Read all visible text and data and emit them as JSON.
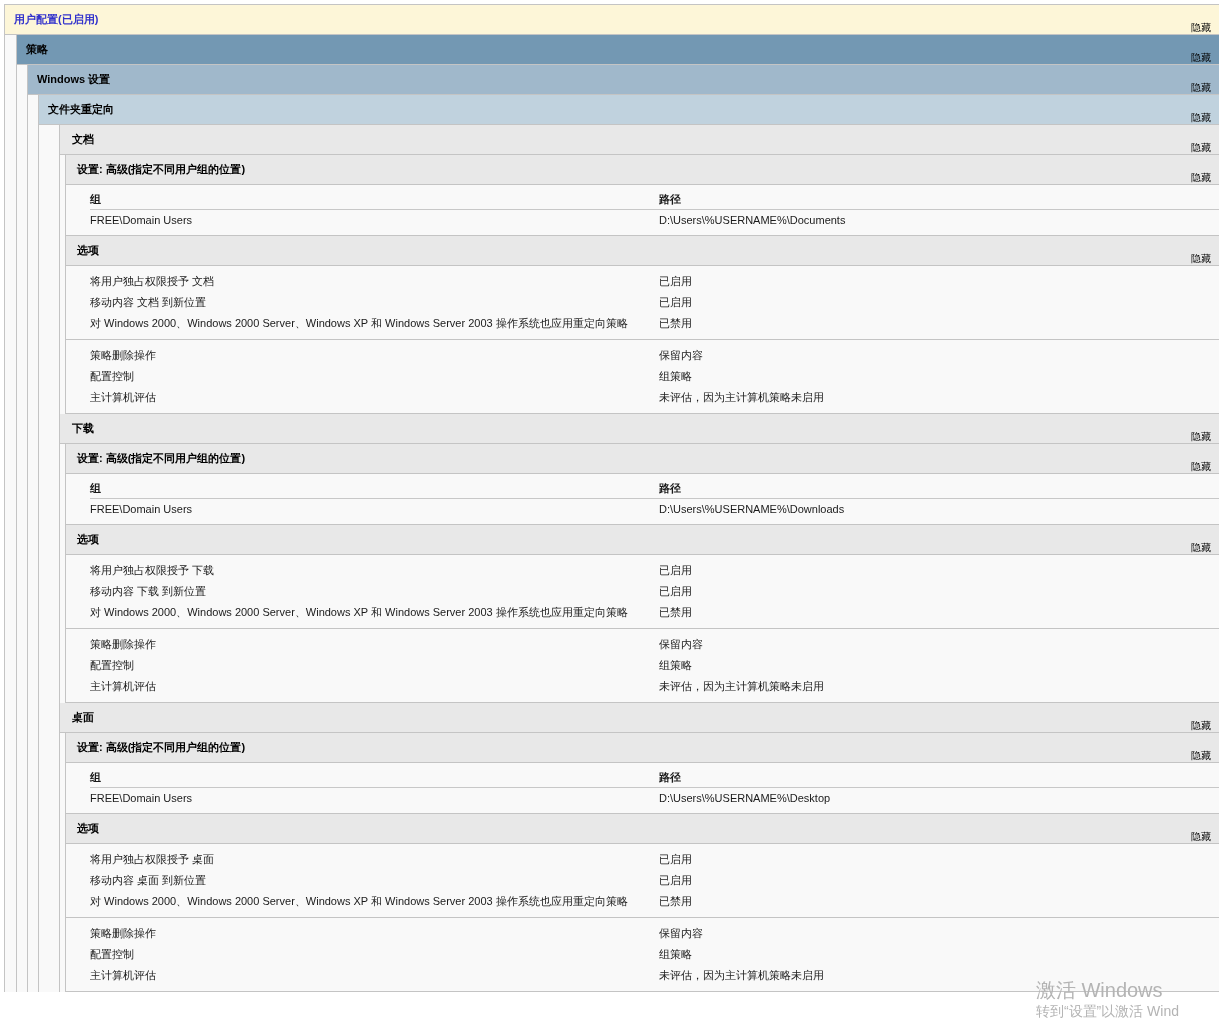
{
  "user_config": {
    "title": "用户配置(已启用)",
    "hide": "隐藏"
  },
  "policies": {
    "title": "策略",
    "hide": "隐藏"
  },
  "windows_settings": {
    "title": "Windows 设置",
    "hide": "隐藏"
  },
  "folder_redirection": {
    "title": "文件夹重定向",
    "hide": "隐藏"
  },
  "folders": [
    {
      "title": "文档",
      "hide": "隐藏",
      "setting": {
        "title": "设置: 高级(指定不同用户组的位置)",
        "hide": "隐藏",
        "columns": [
          "组",
          "路径"
        ],
        "rows": [
          [
            "FREE\\Domain Users",
            "D:\\Users\\%USERNAME%\\Documents"
          ]
        ]
      },
      "options": {
        "title": "选项",
        "hide": "隐藏",
        "groups": [
          [
            {
              "label": "将用户独占权限授予 文档",
              "value": "已启用"
            },
            {
              "label": "移动内容 文档 到新位置",
              "value": "已启用"
            },
            {
              "label": "对 Windows 2000、Windows 2000 Server、Windows XP 和 Windows Server 2003 操作系统也应用重定向策略",
              "value": "已禁用"
            }
          ],
          [
            {
              "label": "策略删除操作",
              "value": "保留内容"
            },
            {
              "label": "配置控制",
              "value": "组策略"
            },
            {
              "label": "主计算机评估",
              "value": "未评估，因为主计算机策略未启用"
            }
          ]
        ]
      }
    },
    {
      "title": "下载",
      "hide": "隐藏",
      "setting": {
        "title": "设置: 高级(指定不同用户组的位置)",
        "hide": "隐藏",
        "columns": [
          "组",
          "路径"
        ],
        "rows": [
          [
            "FREE\\Domain Users",
            "D:\\Users\\%USERNAME%\\Downloads"
          ]
        ]
      },
      "options": {
        "title": "选项",
        "hide": "隐藏",
        "groups": [
          [
            {
              "label": "将用户独占权限授予 下载",
              "value": "已启用"
            },
            {
              "label": "移动内容 下载 到新位置",
              "value": "已启用"
            },
            {
              "label": "对 Windows 2000、Windows 2000 Server、Windows XP 和 Windows Server 2003 操作系统也应用重定向策略",
              "value": "已禁用"
            }
          ],
          [
            {
              "label": "策略删除操作",
              "value": "保留内容"
            },
            {
              "label": "配置控制",
              "value": "组策略"
            },
            {
              "label": "主计算机评估",
              "value": "未评估，因为主计算机策略未启用"
            }
          ]
        ]
      }
    },
    {
      "title": "桌面",
      "hide": "隐藏",
      "setting": {
        "title": "设置: 高级(指定不同用户组的位置)",
        "hide": "隐藏",
        "columns": [
          "组",
          "路径"
        ],
        "rows": [
          [
            "FREE\\Domain Users",
            "D:\\Users\\%USERNAME%\\Desktop"
          ]
        ]
      },
      "options": {
        "title": "选项",
        "hide": "隐藏",
        "groups": [
          [
            {
              "label": "将用户独占权限授予 桌面",
              "value": "已启用"
            },
            {
              "label": "移动内容 桌面 到新位置",
              "value": "已启用"
            },
            {
              "label": "对 Windows 2000、Windows 2000 Server、Windows XP 和 Windows Server 2003 操作系统也应用重定向策略",
              "value": "已禁用"
            }
          ],
          [
            {
              "label": "策略删除操作",
              "value": "保留内容"
            },
            {
              "label": "配置控制",
              "value": "组策略"
            },
            {
              "label": "主计算机评估",
              "value": "未评估，因为主计算机策略未启用"
            }
          ]
        ]
      }
    }
  ],
  "activation": {
    "title": "激活 Windows",
    "hint": "转到“设置”以激活 Wind"
  }
}
